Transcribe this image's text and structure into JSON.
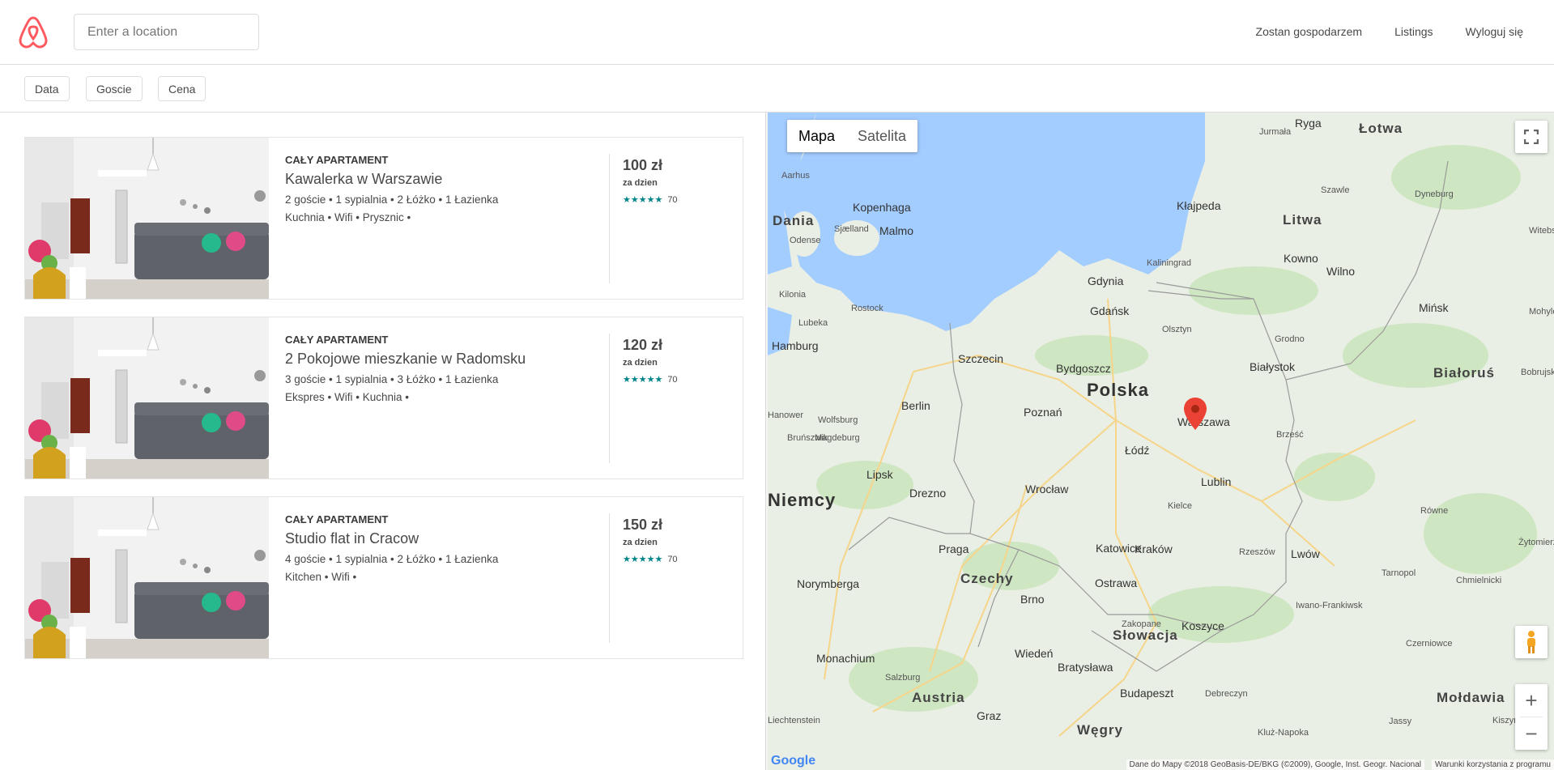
{
  "header": {
    "search_placeholder": "Enter a location",
    "nav": [
      "Zostan gospodarzem",
      "Listings",
      "Wyloguj się"
    ]
  },
  "filters": [
    "Data",
    "Goscie",
    "Cena"
  ],
  "listings": [
    {
      "type": "CAŁY APARTAMENT",
      "title": "Kawalerka w Warszawie",
      "meta": "2 goście • 1 sypialnia • 2 Łóżko • 1 Łazienka",
      "amenities": "Kuchnia • Wifi • Prysznic •",
      "price": "100 zł",
      "per": "za dzien",
      "stars": "★★★★★",
      "reviews": "70"
    },
    {
      "type": "CAŁY APARTAMENT",
      "title": "2 Pokojowe mieszkanie w Radomsku",
      "meta": "3 goście • 1 sypialnia • 3 Łóżko • 1 Łazienka",
      "amenities": "Ekspres • Wifi • Kuchnia •",
      "price": "120 zł",
      "per": "za dzien",
      "stars": "★★★★★",
      "reviews": "70"
    },
    {
      "type": "CAŁY APARTAMENT",
      "title": "Studio flat in Cracow",
      "meta": "4 goście • 1 sypialnia • 2 Łóżko • 1 Łazienka",
      "amenities": "Kitchen • Wifi •",
      "price": "150 zł",
      "per": "za dzien",
      "stars": "★★★★★",
      "reviews": "70"
    }
  ],
  "map": {
    "type_map": "Mapa",
    "type_satellite": "Satelita",
    "countries": [
      "Polska",
      "Niemcy",
      "Czechy",
      "Słowacja",
      "Austria",
      "Węgry",
      "Litwa",
      "Łotwa",
      "Białoruś",
      "Dania",
      "Mołdawia"
    ],
    "cities": [
      "Warszawa",
      "Gdańsk",
      "Gdynia",
      "Kraków",
      "Łódź",
      "Poznań",
      "Wrocław",
      "Lublin",
      "Białystok",
      "Szczecin",
      "Bydgoszcz",
      "Katowice",
      "Kielce",
      "Olsztyn",
      "Berlin",
      "Praga",
      "Wiedeń",
      "Bratysława",
      "Budapeszt",
      "Kopenhaga",
      "Malmo",
      "Kłajpeda",
      "Kowno",
      "Wilno",
      "Ryga",
      "Lipsk",
      "Drezno",
      "Brno",
      "Ostrawa",
      "Lwów",
      "Grodno",
      "Brześć",
      "Rostock",
      "Hamburg",
      "Monachium",
      "Norymberga",
      "Graz",
      "Salzburg",
      "Koszyce",
      "Zakopane",
      "Kaliningrad",
      "Mińsk",
      "Hanower",
      "Magdeburg",
      "Wolfsburg",
      "Rzeszów",
      "Kilonia",
      "Lubeka",
      "Odense",
      "Aarhus",
      "Sjælland",
      "Jurmała",
      "Szawle",
      "Dyneburg",
      "Bruńszwik",
      "Tarnopol",
      "Równe",
      "Iwano-Frankiwsk",
      "Czerniowce",
      "Debreczyn",
      "Kluż-Napoka",
      "Liechtenstein",
      "Kiszyniów",
      "Jassy",
      "Bobrujsk",
      "Żytomierz",
      "Chmielnicki",
      "Witebsk",
      "Mohylew"
    ],
    "attribution": "Dane do Mapy ©2018 GeoBasis-DE/BKG (©2009), Google, Inst. Geogr. Nacional",
    "terms": "Warunki korzystania z programu",
    "google": "Google"
  },
  "colors": {
    "accent": "#FF5A5F",
    "rating": "#008489",
    "water": "#a3ccff",
    "land": "#e9efe4",
    "pin": "#ea4335"
  }
}
